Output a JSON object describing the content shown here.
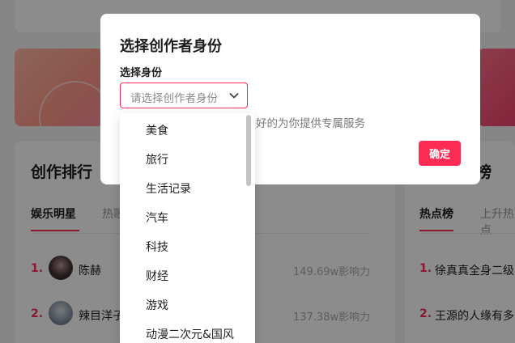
{
  "background": {
    "section_title": "创作排行",
    "section_title_right": "榜",
    "tabs": [
      "娱乐明星",
      "热歌"
    ],
    "tabs_right": [
      "热点榜",
      "上升热点"
    ],
    "ranking": [
      {
        "rank": "1.",
        "name": "陈赫",
        "value": "149.69w影响力"
      },
      {
        "rank": "2.",
        "name": "辣目洋子",
        "value": "137.38w影响力"
      }
    ],
    "hot_list": [
      {
        "rank": "1.",
        "text": "徐真真全身二级"
      },
      {
        "rank": "2.",
        "text": "王源的人缘有多"
      }
    ]
  },
  "modal": {
    "title": "选择创作者身份",
    "field_label": "选择身份",
    "select_placeholder": "请选择创作者身份",
    "hint": "好的为你提供专属服务",
    "confirm_label": "确定"
  },
  "dropdown": {
    "options": [
      "美食",
      "旅行",
      "生活记录",
      "汽车",
      "科技",
      "财经",
      "游戏",
      "动漫二次元&国风"
    ]
  },
  "colors": {
    "accent": "#fe2c55",
    "overlay": "rgba(0,0,0,0.45)"
  }
}
